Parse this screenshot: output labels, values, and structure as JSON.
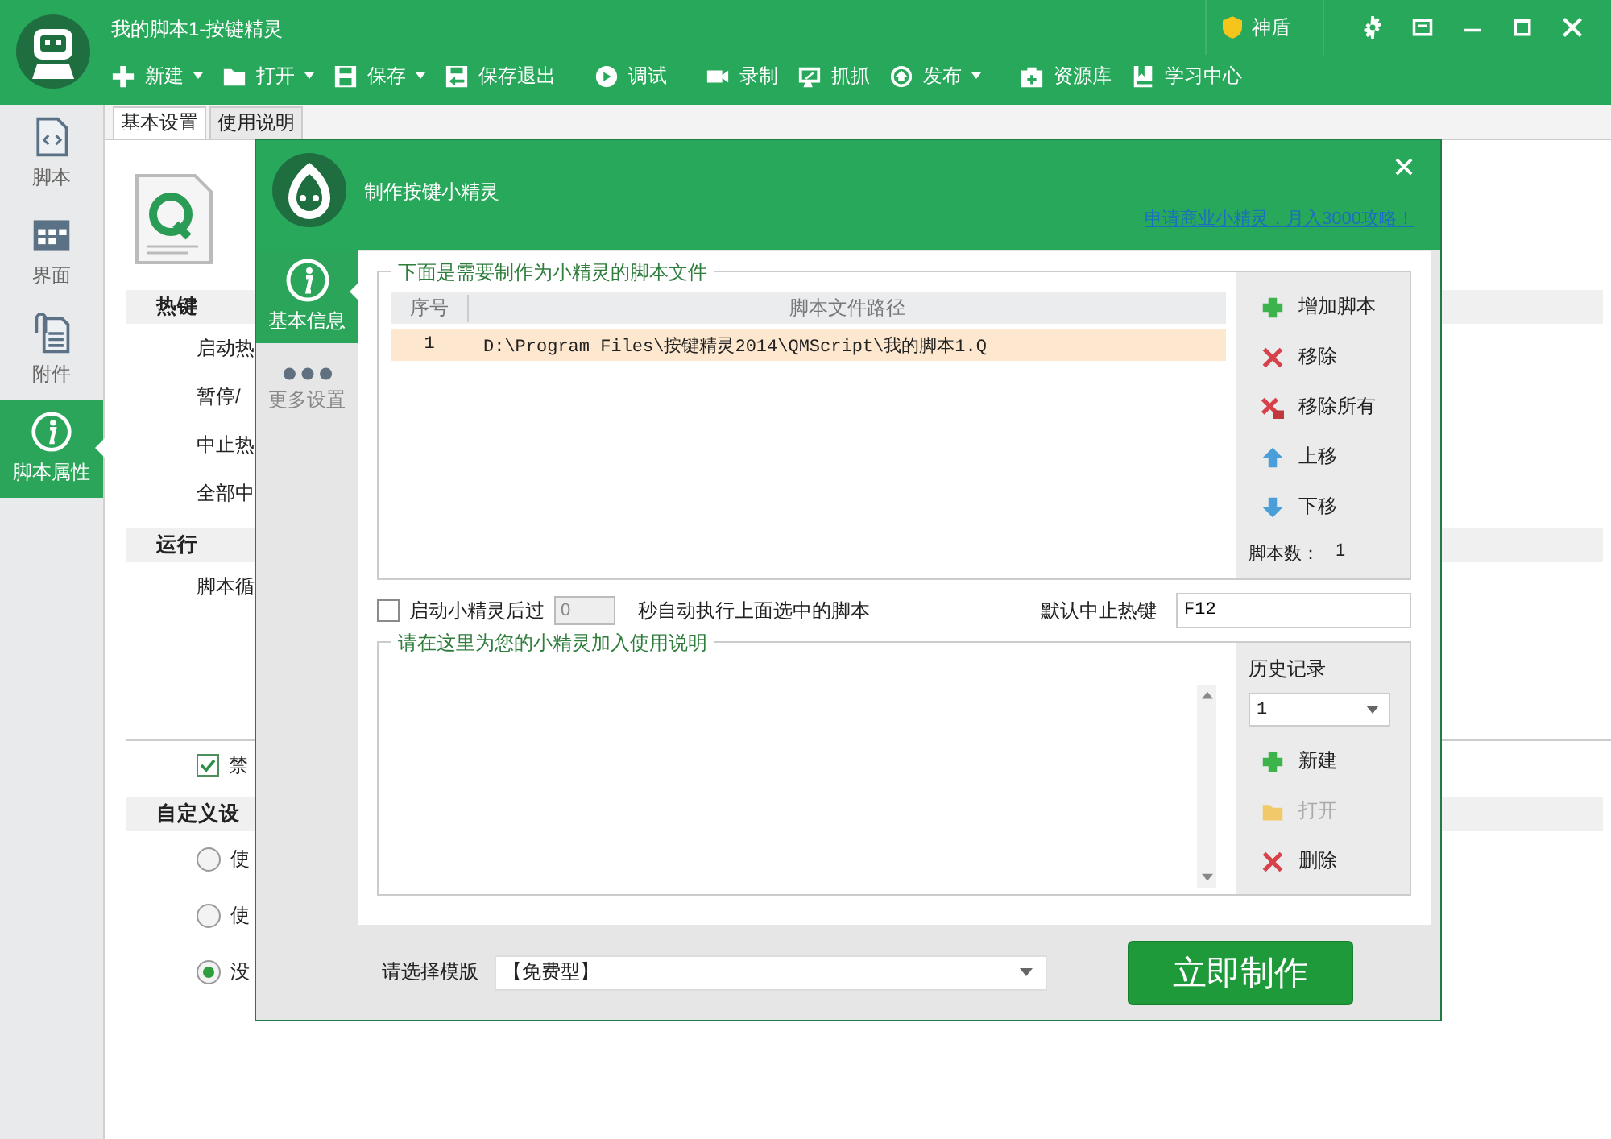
{
  "window": {
    "title": "我的脚本1-按键精灵"
  },
  "shield": {
    "label": "神盾"
  },
  "toolbar": [
    {
      "label": "新建",
      "kind": "plus",
      "dropdown": true
    },
    {
      "label": "打开",
      "kind": "folder",
      "dropdown": true
    },
    {
      "label": "保存",
      "kind": "save",
      "dropdown": true
    },
    {
      "label": "保存退出",
      "kind": "saveexit",
      "dropdown": false
    },
    {
      "label": "调试",
      "kind": "play",
      "dropdown": false,
      "separator_before": true
    },
    {
      "label": "录制",
      "kind": "camera",
      "dropdown": false,
      "separator_before": true
    },
    {
      "label": "抓抓",
      "kind": "capture",
      "dropdown": false
    },
    {
      "label": "发布",
      "kind": "publish",
      "dropdown": true
    },
    {
      "label": "资源库",
      "kind": "case",
      "dropdown": false,
      "separator_before": true
    },
    {
      "label": "学习中心",
      "kind": "book",
      "dropdown": false
    }
  ],
  "sidebar": {
    "items": [
      {
        "label": "脚本",
        "kind": "code",
        "selected": false
      },
      {
        "label": "界面",
        "kind": "grid",
        "selected": false
      },
      {
        "label": "附件",
        "kind": "clip",
        "selected": false
      },
      {
        "label": "脚本属性",
        "kind": "info",
        "selected": true
      }
    ]
  },
  "tabs": [
    {
      "label": "基本设置",
      "selected": true
    },
    {
      "label": "使用说明",
      "selected": false
    }
  ],
  "hotkeys": {
    "title": "热键",
    "rows": [
      "启动热",
      "暂停/",
      "中止热",
      "全部中"
    ]
  },
  "run": {
    "title": "运行",
    "rows": [
      "脚本循"
    ]
  },
  "disable_option": {
    "label": "禁",
    "checked": true
  },
  "custom": {
    "title": "自定义设",
    "options": [
      {
        "label": "使",
        "selected": false
      },
      {
        "label": "使",
        "selected": false
      },
      {
        "label": "没",
        "selected": true
      }
    ]
  },
  "dialog": {
    "title": "制作按键小精灵",
    "promo_link": "申请商业小精灵，月入3000攻略！",
    "nav": [
      {
        "label": "基本信息",
        "kind": "info",
        "selected": true
      },
      {
        "label": "更多设置",
        "kind": "dots",
        "selected": false
      }
    ],
    "scripts": {
      "legend": "下面是需要制作为小精灵的脚本文件",
      "columns": [
        "序号",
        "脚本文件路径"
      ],
      "rows": [
        {
          "index": "1",
          "path": "D:\\Program Files\\按键精灵2014\\QMScript\\我的脚本1.Q",
          "selected": true
        }
      ],
      "actions": [
        {
          "label": "增加脚本",
          "kind": "add"
        },
        {
          "label": "移除",
          "kind": "remove"
        },
        {
          "label": "移除所有",
          "kind": "remove_all"
        },
        {
          "label": "上移",
          "kind": "up"
        },
        {
          "label": "下移",
          "kind": "down"
        }
      ],
      "count_label": "脚本数：",
      "count": "1"
    },
    "autorun": {
      "label": "启动小精灵后过",
      "checked": false,
      "seconds": "0",
      "suffix": "秒自动执行上面选中的脚本"
    },
    "stop_hotkey": {
      "label": "默认中止热键",
      "value": "F12"
    },
    "description": {
      "legend": "请在这里为您的小精灵加入使用说明"
    },
    "history": {
      "label": "历史记录",
      "value": "1",
      "actions": [
        {
          "label": "新建",
          "kind": "add",
          "disabled": false
        },
        {
          "label": "打开",
          "kind": "open",
          "disabled": true
        },
        {
          "label": "删除",
          "kind": "remove",
          "disabled": false
        }
      ]
    },
    "template": {
      "label": "请选择模版",
      "value": "【免费型】"
    },
    "make_button": "立即制作"
  }
}
